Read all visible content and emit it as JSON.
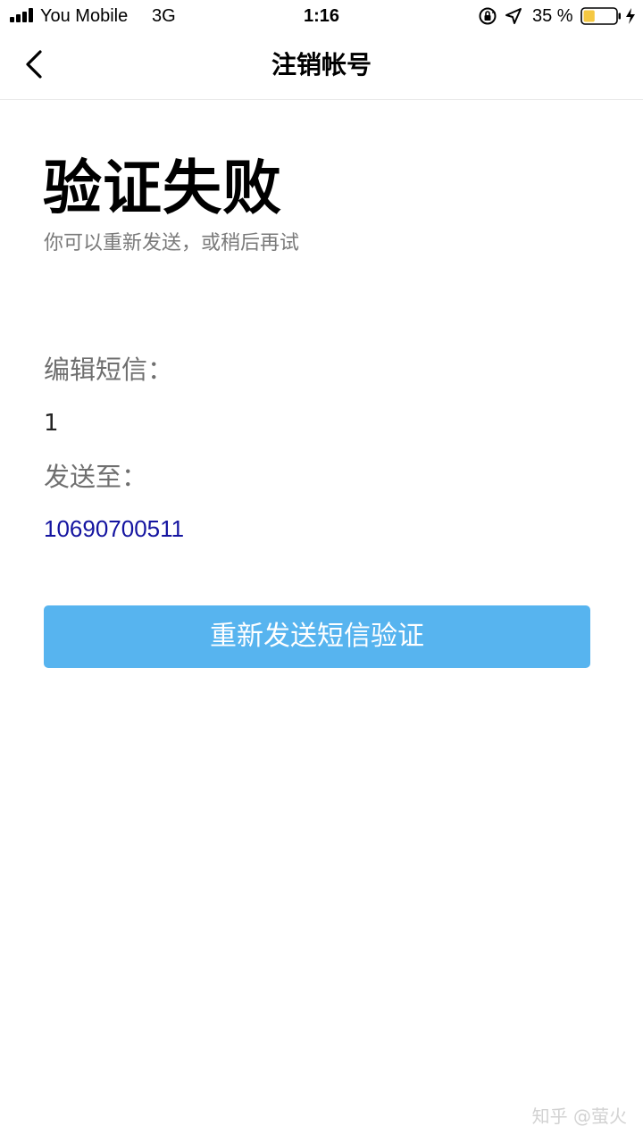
{
  "status_bar": {
    "carrier": "You Mobile",
    "network": "3G",
    "time": "1:16",
    "battery_percent": "35 %",
    "battery_level": 0.35,
    "signal_bars": 4,
    "icons": [
      "rotation-lock-icon",
      "location-icon",
      "battery-icon",
      "charging-icon"
    ],
    "battery_fill_color": "#f5c842"
  },
  "nav": {
    "title": "注销帐号",
    "back_icon": "chevron-left-icon"
  },
  "content": {
    "title": "验证失败",
    "subtitle": "你可以重新发送，或稍后再试",
    "sms_label": "编辑短信：",
    "sms_content": "1",
    "send_to_label": "发送至：",
    "phone_number": "10690700511",
    "resend_button": "重新发送短信验证"
  },
  "colors": {
    "button": "#57b4ef",
    "link": "#1414a0"
  },
  "watermark": "知乎 @萤火"
}
